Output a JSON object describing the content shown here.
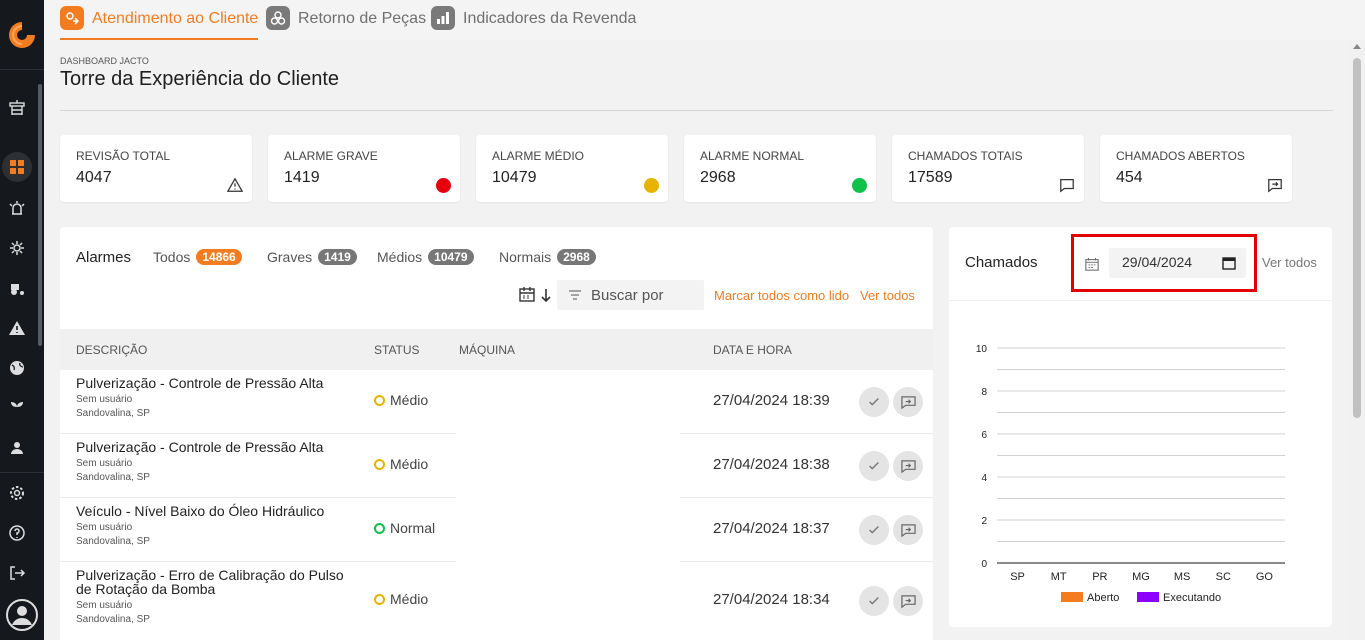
{
  "tabs": [
    {
      "label": "Atendimento ao Cliente",
      "active": true
    },
    {
      "label": "Retorno de Peças",
      "active": false
    },
    {
      "label": "Indicadores da Revenda",
      "active": false
    }
  ],
  "page": {
    "breadcrumb": "DASHBOARD JACTO",
    "title": "Torre da Experiência do Cliente"
  },
  "cards": [
    {
      "label": "REVISÃO TOTAL",
      "value": "4047",
      "icon": "warning-icon"
    },
    {
      "label": "ALARME GRAVE",
      "value": "1419",
      "icon": "red-dot",
      "color": "#e8000d"
    },
    {
      "label": "ALARME MÉDIO",
      "value": "10479",
      "icon": "yellow-dot",
      "color": "#e6b400"
    },
    {
      "label": "ALARME NORMAL",
      "value": "2968",
      "icon": "green-dot",
      "color": "#10c24a"
    },
    {
      "label": "CHAMADOS TOTAIS",
      "value": "17589",
      "icon": "chat-icon"
    },
    {
      "label": "CHAMADOS ABERTOS",
      "value": "454",
      "icon": "chat-forward-icon"
    }
  ],
  "alarms": {
    "title": "Alarmes",
    "filters": [
      {
        "label": "Todos",
        "count": "14866"
      },
      {
        "label": "Graves",
        "count": "1419"
      },
      {
        "label": "Médios",
        "count": "10479"
      },
      {
        "label": "Normais",
        "count": "2968"
      }
    ],
    "search_placeholder": "Buscar por",
    "mark_all": "Marcar todos como lido",
    "see_all": "Ver todos",
    "columns": [
      "DESCRIÇÃO",
      "STATUS",
      "MÁQUINA",
      "DATA E HORA"
    ],
    "rows": [
      {
        "desc": "Pulverização - Controle de Pressão Alta",
        "user": "Sem usuário",
        "location": "Sandovalina, SP",
        "status": "Médio",
        "status_color": "#e6b400",
        "machine": "",
        "datetime": "27/04/2024 18:39"
      },
      {
        "desc": "Pulverização - Controle de Pressão Alta",
        "user": "Sem usuário",
        "location": "Sandovalina, SP",
        "status": "Médio",
        "status_color": "#e6b400",
        "machine": "",
        "datetime": "27/04/2024 18:38"
      },
      {
        "desc": "Veículo - Nível Baixo do Óleo Hidráulico",
        "user": "Sem usuário",
        "location": "Sandovalina, SP",
        "status": "Normal",
        "status_color": "#10c24a",
        "machine": "",
        "datetime": "27/04/2024 18:37"
      },
      {
        "desc": "Pulverização - Erro de Calibração do Pulso de Rotação da Bomba",
        "user": "Sem usuário",
        "location": "Sandovalina, SP",
        "status": "Médio",
        "status_color": "#e6b400",
        "machine": "",
        "datetime": "27/04/2024 18:34"
      }
    ]
  },
  "chamados": {
    "title": "Chamados",
    "date": "29/04/2024",
    "see_all": "Ver todos"
  },
  "chart_data": {
    "type": "bar",
    "categories": [
      "SP",
      "MT",
      "PR",
      "MG",
      "MS",
      "SC",
      "GO"
    ],
    "series": [
      {
        "name": "Aberto",
        "color": "#f47c20",
        "values": [
          0,
          0,
          0,
          0,
          0,
          0,
          0
        ]
      },
      {
        "name": "Executando",
        "color": "#8b00ff",
        "values": [
          0,
          0,
          0,
          0,
          0,
          0,
          0
        ]
      }
    ],
    "yticks": [
      "0",
      "2",
      "4",
      "6",
      "8",
      "10"
    ],
    "ylim": [
      0,
      10
    ],
    "legend": "bottom",
    "grid": true
  }
}
